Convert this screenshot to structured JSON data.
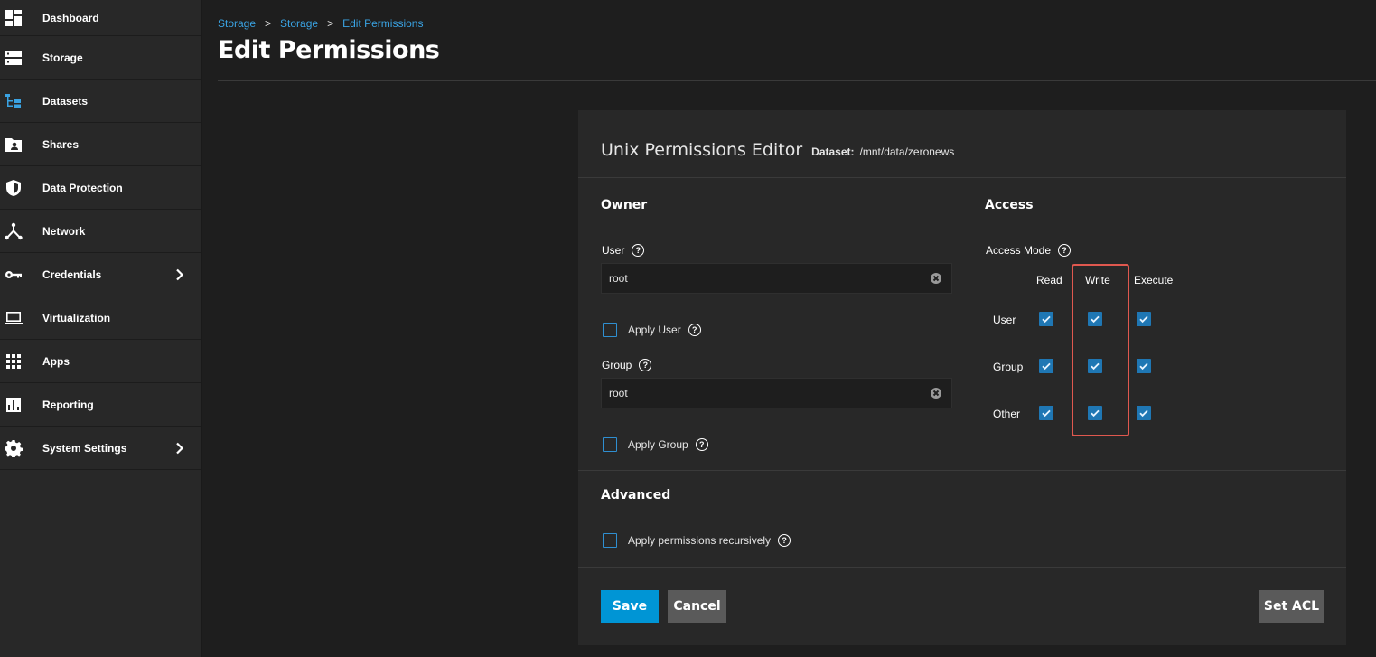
{
  "sidebar": {
    "items": [
      {
        "label": "Dashboard",
        "icon": "dashboard-icon"
      },
      {
        "label": "Storage",
        "icon": "storage-icon"
      },
      {
        "label": "Datasets",
        "icon": "datasets-icon"
      },
      {
        "label": "Shares",
        "icon": "shares-icon"
      },
      {
        "label": "Data Protection",
        "icon": "shield-icon"
      },
      {
        "label": "Network",
        "icon": "network-icon"
      },
      {
        "label": "Credentials",
        "icon": "key-icon",
        "has_children": true
      },
      {
        "label": "Virtualization",
        "icon": "laptop-icon"
      },
      {
        "label": "Apps",
        "icon": "apps-grid-icon"
      },
      {
        "label": "Reporting",
        "icon": "chart-icon"
      },
      {
        "label": "System Settings",
        "icon": "gear-icon",
        "has_children": true
      }
    ]
  },
  "breadcrumb": {
    "items": [
      "Storage",
      "Storage",
      "Edit Permissions"
    ],
    "separator": ">"
  },
  "page": {
    "title": "Edit Permissions"
  },
  "editor": {
    "title": "Unix Permissions Editor",
    "dataset_label": "Dataset:",
    "dataset_value": "/mnt/data/zeronews",
    "owner": {
      "section_title": "Owner",
      "user_label": "User",
      "user_value": "root",
      "apply_user_label": "Apply User",
      "apply_user_checked": false,
      "group_label": "Group",
      "group_value": "root",
      "apply_group_label": "Apply Group",
      "apply_group_checked": false
    },
    "access": {
      "section_title": "Access",
      "mode_label": "Access Mode",
      "columns": [
        "Read",
        "Write",
        "Execute"
      ],
      "rows": [
        {
          "label": "User",
          "values": [
            true,
            true,
            true
          ]
        },
        {
          "label": "Group",
          "values": [
            true,
            true,
            true
          ]
        },
        {
          "label": "Other",
          "values": [
            true,
            true,
            true
          ]
        }
      ],
      "highlighted_column": "Write"
    },
    "advanced": {
      "section_title": "Advanced",
      "recursive_label": "Apply permissions recursively",
      "recursive_checked": false
    },
    "buttons": {
      "save": "Save",
      "cancel": "Cancel",
      "set_acl": "Set ACL"
    }
  },
  "colors": {
    "accent": "#0095d5",
    "link": "#3aa3e3",
    "checkbox": "#1f77b4",
    "highlight": "#e0584f",
    "background": "#1e1e1e",
    "panel": "#282828"
  }
}
